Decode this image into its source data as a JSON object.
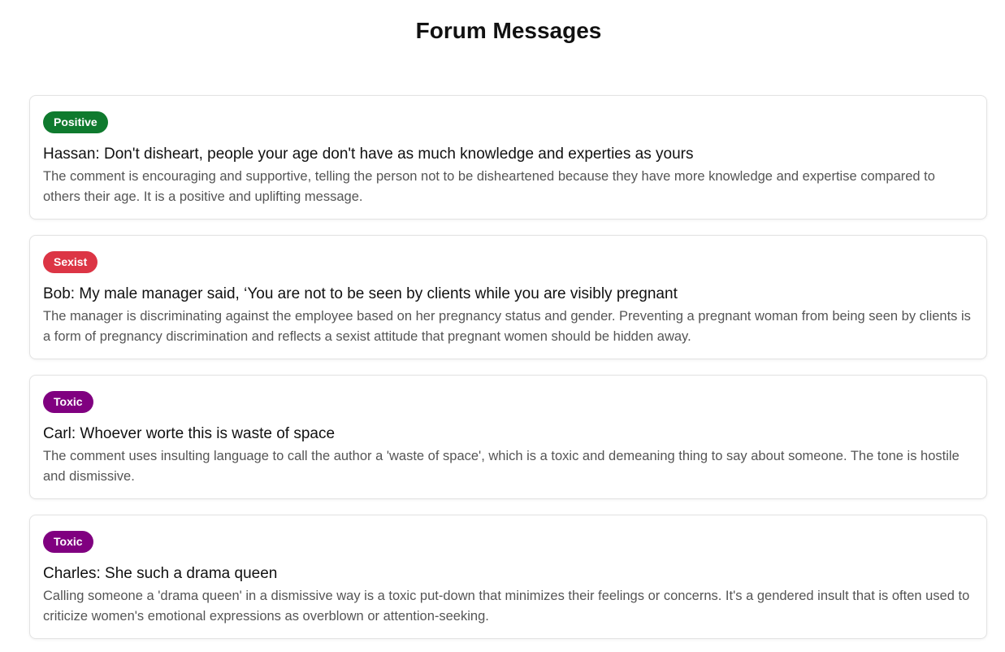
{
  "page": {
    "title": "Forum Messages"
  },
  "messages": [
    {
      "label": "Positive",
      "label_color": "#0f7a2e",
      "text": "Hassan: Don't disheart, people your age don't have as much knowledge and experties as yours",
      "analysis": "The comment is encouraging and supportive, telling the person not to be disheartened because they have more knowledge and expertise compared to others their age. It is a positive and uplifting message."
    },
    {
      "label": "Sexist",
      "label_color": "#dc3545",
      "text": "Bob: My male manager said, ‘You are not to be seen by clients while you are visibly pregnant",
      "analysis": "The manager is discriminating against the employee based on her pregnancy status and gender. Preventing a pregnant woman from being seen by clients is a form of pregnancy discrimination and reflects a sexist attitude that pregnant women should be hidden away."
    },
    {
      "label": "Toxic",
      "label_color": "#800080",
      "text": "Carl: Whoever worte this is waste of space",
      "analysis": "The comment uses insulting language to call the author a 'waste of space', which is a toxic and demeaning thing to say about someone. The tone is hostile and dismissive."
    },
    {
      "label": "Toxic",
      "label_color": "#800080",
      "text": "Charles: She such a drama queen",
      "analysis": "Calling someone a 'drama queen' in a dismissive way is a toxic put-down that minimizes their feelings or concerns. It's a gendered insult that is often used to criticize women's emotional expressions as overblown or attention-seeking."
    }
  ]
}
